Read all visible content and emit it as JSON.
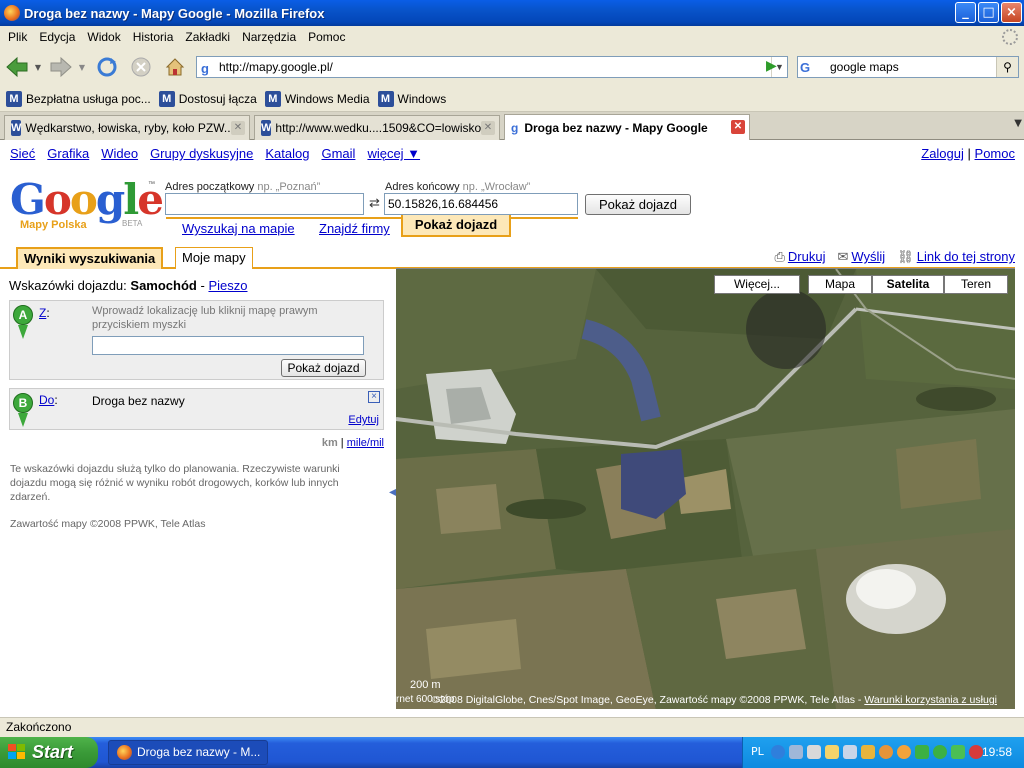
{
  "window": {
    "title": "Droga bez nazwy - Mapy Google - Mozilla Firefox",
    "min": "_",
    "max": "□",
    "close": "×"
  },
  "menu": [
    "Plik",
    "Edycja",
    "Widok",
    "Historia",
    "Zakładki",
    "Narzędzia",
    "Pomoc"
  ],
  "toolbar": {
    "url": "http://mapy.google.pl/",
    "search_engine": "G",
    "search_value": "google maps"
  },
  "bookmarks": [
    "Bezpłatna usługa poc...",
    "Dostosuj łącza",
    "Windows Media",
    "Windows"
  ],
  "tabs": [
    {
      "label": "Wędkarstwo, łowiska, ryby, koło PZW..."
    },
    {
      "label": "http://www.wedku....1509&CO=lowisko"
    },
    {
      "label": "Droga bez nazwy - Mapy Google"
    }
  ],
  "google": {
    "gbar": [
      "Sieć",
      "Grafika",
      "Wideo",
      "Grupy dyskusyjne",
      "Katalog",
      "Gmail",
      "więcej ▼"
    ],
    "login": "Zaloguj",
    "sep": "|",
    "help": "Pomoc",
    "logo_word": "Google",
    "logo_sub": "Mapy Polska",
    "logo_beta": "BETA",
    "tm": "™"
  },
  "directions_form": {
    "start_label": "Adres początkowy",
    "start_hint": "np. „Poznań”",
    "start_value": "",
    "end_label": "Adres końcowy",
    "end_hint": "np. „Wrocław”",
    "end_value": "50.15826,16.684456",
    "submit": "Pokaż dojazd",
    "swap": "⇄"
  },
  "search_tabs": {
    "search": "Wyszukaj na mapie",
    "business": "Znajdź firmy",
    "directions": "Pokaż dojazd"
  },
  "result_tabs": {
    "results": "Wyniki wyszukiwania",
    "mymaps": "Moje mapy"
  },
  "actions": {
    "print": "Drukuj",
    "send": "Wyślij",
    "link": "Link do tej strony"
  },
  "panel": {
    "modes_label": "Wskazówki dojazdu:",
    "mode_car": "Samochód",
    "mode_dash": "-",
    "mode_walk": "Pieszo",
    "from_pin": "A",
    "from_link": "Z",
    "colon": ":",
    "from_hint": "Wprowadź lokalizację lub kliknij mapę prawym przyciskiem myszki",
    "from_value": "",
    "from_button": "Pokaż dojazd",
    "to_pin": "B",
    "to_link": "Do",
    "to_value": "Droga bez nazwy",
    "edit": "Edytuj",
    "remove": "×",
    "unit_km": "km",
    "unit_sep": "|",
    "unit_mi": "mile/mil",
    "disclaimer": "Te wskazówki dojazdu służą tylko do planowania. Rzeczywiste warunki dojazdu mogą się różnić w wyniku robót drogowych, korków lub innych zdarzeń.",
    "copyright": "Zawartość mapy ©2008 PPWK, Tele Atlas"
  },
  "map": {
    "more": "Więcej...",
    "map": "Mapa",
    "satellite": "Satelita",
    "terrain": "Teren",
    "scale": "200 m",
    "scale2": "rnet 600 stóp",
    "copyright": "©2008 DigitalGlobe, Cnes/Spot Image, GeoEye, Zawartość mapy ©2008 PPWK, Tele Atlas -",
    "terms": "Warunki korzystania z usługi"
  },
  "status": {
    "text": "Zakończono"
  },
  "taskbar": {
    "start": "Start",
    "task": "Droga bez nazwy - M...",
    "lang": "PL",
    "clock": "19:58"
  }
}
